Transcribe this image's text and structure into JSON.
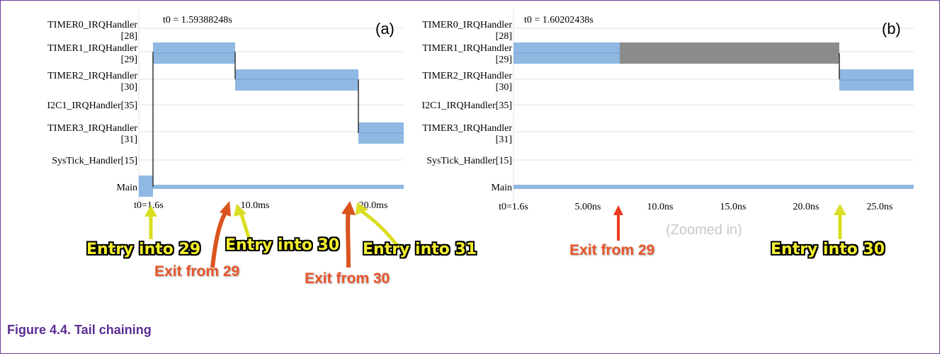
{
  "charts": [
    {
      "id": "a",
      "panel_label": "(a)",
      "t0_label": "t0 = 1.59388248s",
      "y_labels": [
        [
          "TIMER0_IRQHandler",
          "[28]"
        ],
        [
          "TIMER1_IRQHandler",
          "[29]"
        ],
        [
          "TIMER2_IRQHandler",
          "[30]"
        ],
        [
          "I2C1_IRQHandler[35]"
        ],
        [
          "TIMER3_IRQHandler",
          "[31]"
        ],
        [
          "SysTick_Handler[15]"
        ],
        [
          "Main"
        ]
      ],
      "x_ticks": [
        "t0=1.6s",
        "10.0ms",
        "20.0ms"
      ],
      "bar_color": "#8fb8e2",
      "inactive_color": "#8c8c8c"
    },
    {
      "id": "b",
      "panel_label": "(b)",
      "t0_label": "t0 = 1.60202438s",
      "y_labels": [
        [
          "TIMER0_IRQHandler",
          "[28]"
        ],
        [
          "TIMER1_IRQHandler",
          "[29]"
        ],
        [
          "TIMER2_IRQHandler",
          "[30]"
        ],
        [
          "I2C1_IRQHandler[35]"
        ],
        [
          "TIMER3_IRQHandler",
          "[31]"
        ],
        [
          "SysTick_Handler[15]"
        ],
        [
          "Main"
        ]
      ],
      "x_ticks": [
        "t0=1.6s",
        "5.00ns",
        "10.0ns",
        "15.0ns",
        "20.0ns",
        "25.0ns"
      ],
      "bar_color": "#8fb8e2",
      "inactive_color": "#8c8c8c"
    }
  ],
  "annotations": {
    "entry_29": "Entry into 29",
    "exit_29": "Exit from 29",
    "entry_30": "Entry into 30",
    "exit_30": "Exit from 30",
    "entry_31": "Entry into 31",
    "exit_29_b": "Exit from 29",
    "entry_30_b": "Entry into 30",
    "zoomed": "(Zoomed in)"
  },
  "caption": "Figure 4.4. Tail chaining"
}
